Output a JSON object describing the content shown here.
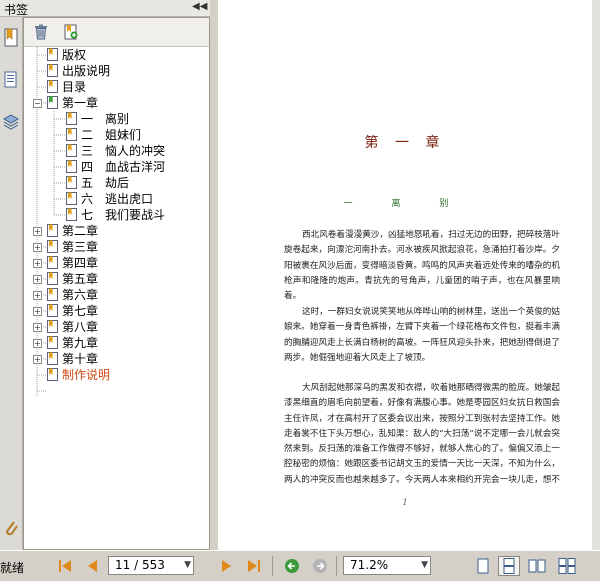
{
  "panel": {
    "title": "书签"
  },
  "tree": {
    "items": [
      {
        "label": "版权"
      },
      {
        "label": "出版说明"
      },
      {
        "label": "目录"
      },
      {
        "label": "第一章"
      },
      {
        "label": "一　离别"
      },
      {
        "label": "二　姐妹们"
      },
      {
        "label": "三　恼人的冲突"
      },
      {
        "label": "四　血战古洋河"
      },
      {
        "label": "五　劫后"
      },
      {
        "label": "六　逃出虎口"
      },
      {
        "label": "七　我们要战斗"
      },
      {
        "label": "第二章"
      },
      {
        "label": "第三章"
      },
      {
        "label": "第四章"
      },
      {
        "label": "第五章"
      },
      {
        "label": "第六章"
      },
      {
        "label": "第七章"
      },
      {
        "label": "第八章"
      },
      {
        "label": "第九章"
      },
      {
        "label": "第十章"
      },
      {
        "label": "制作说明"
      }
    ]
  },
  "document": {
    "chapter_title": "第 一 章",
    "section_title": "一 离 别",
    "paragraphs": [
      "西北风卷着漫漫黄沙，凶猛地怒吼着，扫过无边的田野，把碎枝落叶旋卷起来，向漂沱河南扑去。河水被疾风掀起浪花，急涌拍打着沙岸。夕阳被裹在风沙后面，变得暗淡昏黄。鸣鸣的风声夹着远处传来的嘈杂的机枪声和隆隆的炮声。青抗先的号角声，儿童团的哨子声，也在风暴里响着。",
      "这时，一群妇女说说笑笑地从哗哗山响的树林里，送出一个英俊的姑娘来。她穿着一身青色裤褂，左臂下夹着一个绿花格布文件包，挺着丰满的胸脯迎风走上长满白杨树的高坡。一阵狂风迎头扑来，把她刮得倒退了两步。她倔强地迎着大风走上了坡顶。",
      "大风刮起她那深乌的黑发和衣襟，吹着她那晒得微黑的脸庞。她皱起漆黑细直的眉毛向前望着，好像有满腹心事。她是枣园区妇女抗日救国会主任许凤，才在高村开了区委会议出来，按照分工到张村去坚持工作。她走着裳不住下头万想心，乱知渠：敌人的“大扫荡”说不定哪一会儿就会突然来到。反扫荡的准备工作做得不够好，就够人焦心的了。偏偏又添上一腔秘密的烦恼：她跟区委书记胡文玉的爱情一天比一天深，不知为什么，两人的冲突反而也越来越多了。今天两人本来相约开完会一块儿走，想不到在会上为开"
    ],
    "page_marker": "1"
  },
  "status": {
    "text": "就绪",
    "page_field": "11 / 553",
    "zoom_field": "71.2%"
  },
  "colors": {
    "accent_red": "#d24a10",
    "chapter_title": "#7a1e0e",
    "section_title": "#2f6d2f",
    "nav_orange": "#e08a1e",
    "nav_green": "#3a9a3a"
  }
}
